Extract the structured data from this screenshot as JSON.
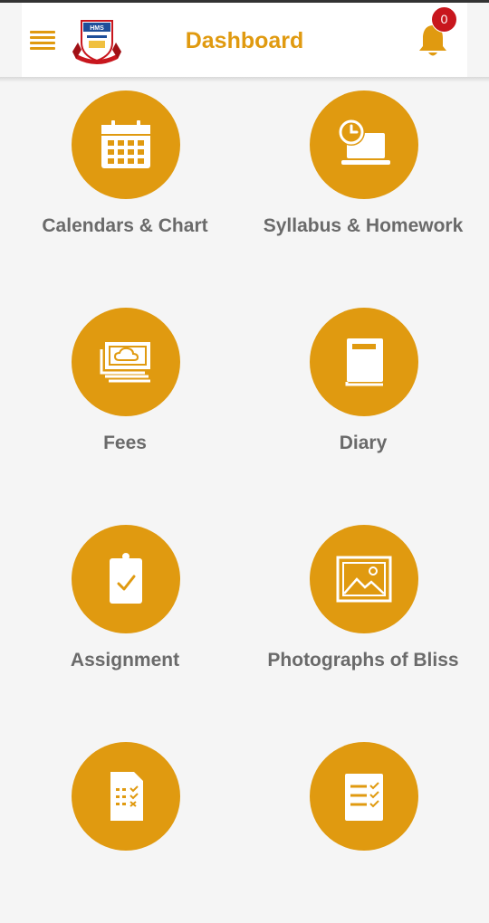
{
  "header": {
    "title": "Dashboard",
    "notification_count": "0",
    "logo_text": "HMS"
  },
  "colors": {
    "accent": "#e09a10",
    "badge": "#c8161d",
    "label": "#6a6a6a",
    "background": "#f5f5f5"
  },
  "tiles": [
    {
      "label": "Calendars & Chart",
      "icon": "calendar-icon"
    },
    {
      "label": "Syllabus & Homework",
      "icon": "clock-laptop-icon"
    },
    {
      "label": "Fees",
      "icon": "money-icon"
    },
    {
      "label": "Diary",
      "icon": "book-icon"
    },
    {
      "label": "Assignment",
      "icon": "clipboard-check-icon"
    },
    {
      "label": "Photographs of Bliss",
      "icon": "photo-icon"
    },
    {
      "label": "",
      "icon": "test-sheet-icon"
    },
    {
      "label": "",
      "icon": "checklist-icon"
    }
  ]
}
